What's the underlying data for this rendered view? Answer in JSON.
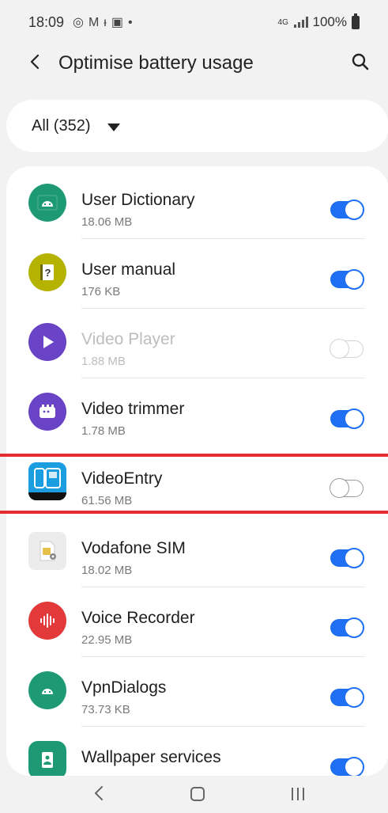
{
  "status_bar": {
    "time": "18:09",
    "left_icons": [
      "sync-icon",
      "gmail-icon",
      "figure-icon",
      "image-icon",
      "dot-icon"
    ],
    "network": "4G",
    "battery": "100%"
  },
  "header": {
    "title": "Optimise battery usage"
  },
  "filter": {
    "label": "All (352)"
  },
  "apps": [
    {
      "name": "User Dictionary",
      "size": "18.06 MB",
      "enabled": true,
      "icon": "android-icon",
      "color": "#1d9a73"
    },
    {
      "name": "User manual",
      "size": "176 KB",
      "enabled": true,
      "icon": "manual-icon",
      "color": "#b6b200"
    },
    {
      "name": "Video Player",
      "size": "1.88 MB",
      "enabled": false,
      "disabled_row": true,
      "icon": "play-icon",
      "color": "#6a43c7"
    },
    {
      "name": "Video trimmer",
      "size": "1.78 MB",
      "enabled": true,
      "icon": "video-trimmer-icon",
      "color": "#6a43c7"
    },
    {
      "name": "VideoEntry",
      "size": "61.56 MB",
      "enabled": false,
      "icon": "videoentry-icon",
      "color": "#1b9de0"
    },
    {
      "name": "Vodafone SIM",
      "size": "18.02 MB",
      "enabled": true,
      "icon": "sim-icon",
      "color": "#e8e8e8"
    },
    {
      "name": "Voice Recorder",
      "size": "22.95 MB",
      "enabled": true,
      "icon": "recorder-icon",
      "color": "#e23a3a"
    },
    {
      "name": "VpnDialogs",
      "size": "73.73 KB",
      "enabled": true,
      "icon": "android-icon",
      "color": "#1d9a73"
    },
    {
      "name": "Wallpaper services",
      "size": "",
      "enabled": true,
      "icon": "wallpaper-icon",
      "color": "#1d9a73"
    }
  ],
  "nav": {
    "buttons": [
      "back-icon",
      "home-icon",
      "recents-icon"
    ]
  }
}
